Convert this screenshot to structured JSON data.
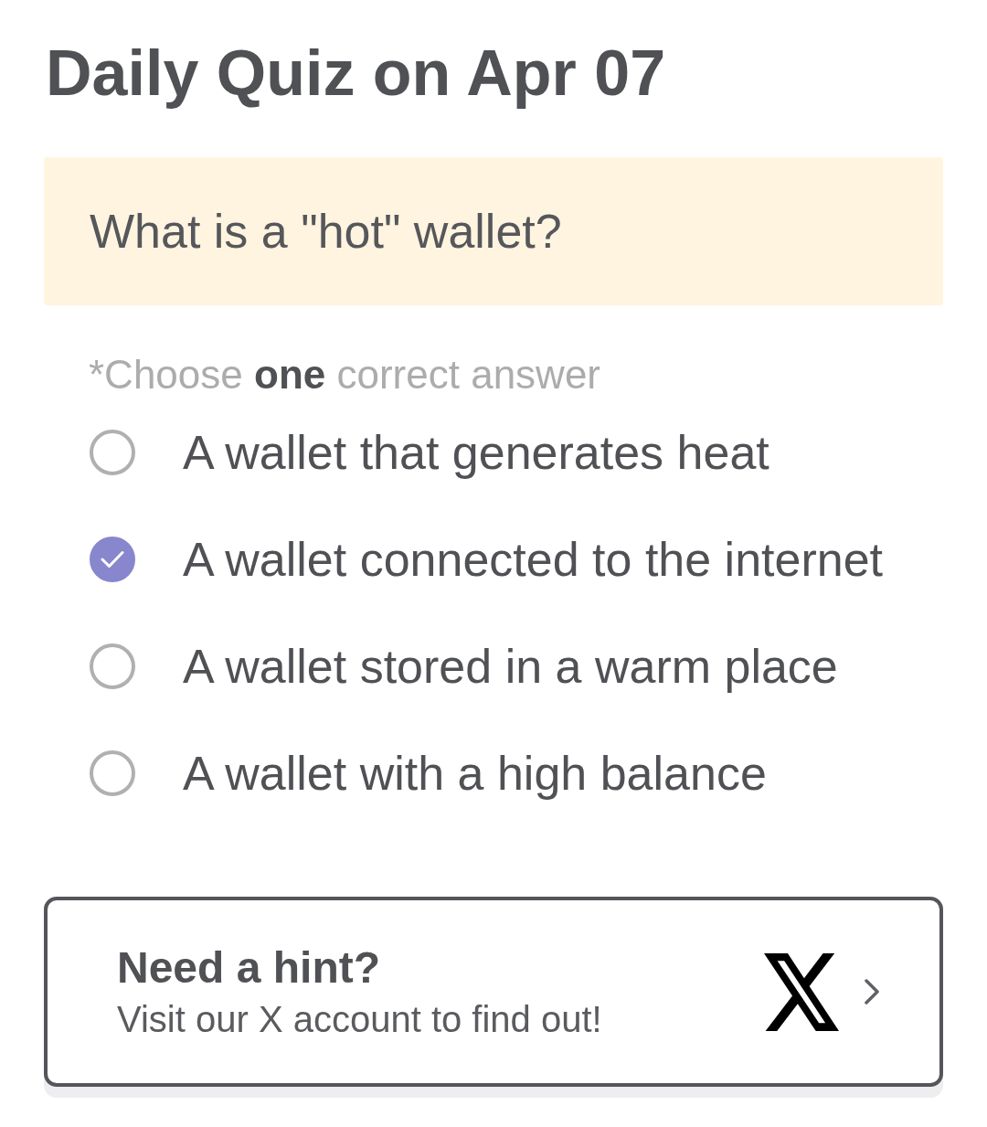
{
  "title": "Daily Quiz on Apr 07",
  "question": {
    "text": "What is a \"hot\" wallet?"
  },
  "instruction": "*Choose **one** correct answer",
  "options": [
    {
      "label": "A wallet that generates heat",
      "selected": false
    },
    {
      "label": "A wallet connected to the internet",
      "selected": true
    },
    {
      "label": "A wallet stored in a warm place",
      "selected": false
    },
    {
      "label": "A wallet with a high balance",
      "selected": false
    }
  ],
  "hint_card": {
    "title": "Need a hint?",
    "subtitle": "Visit our X account to find out!"
  }
}
